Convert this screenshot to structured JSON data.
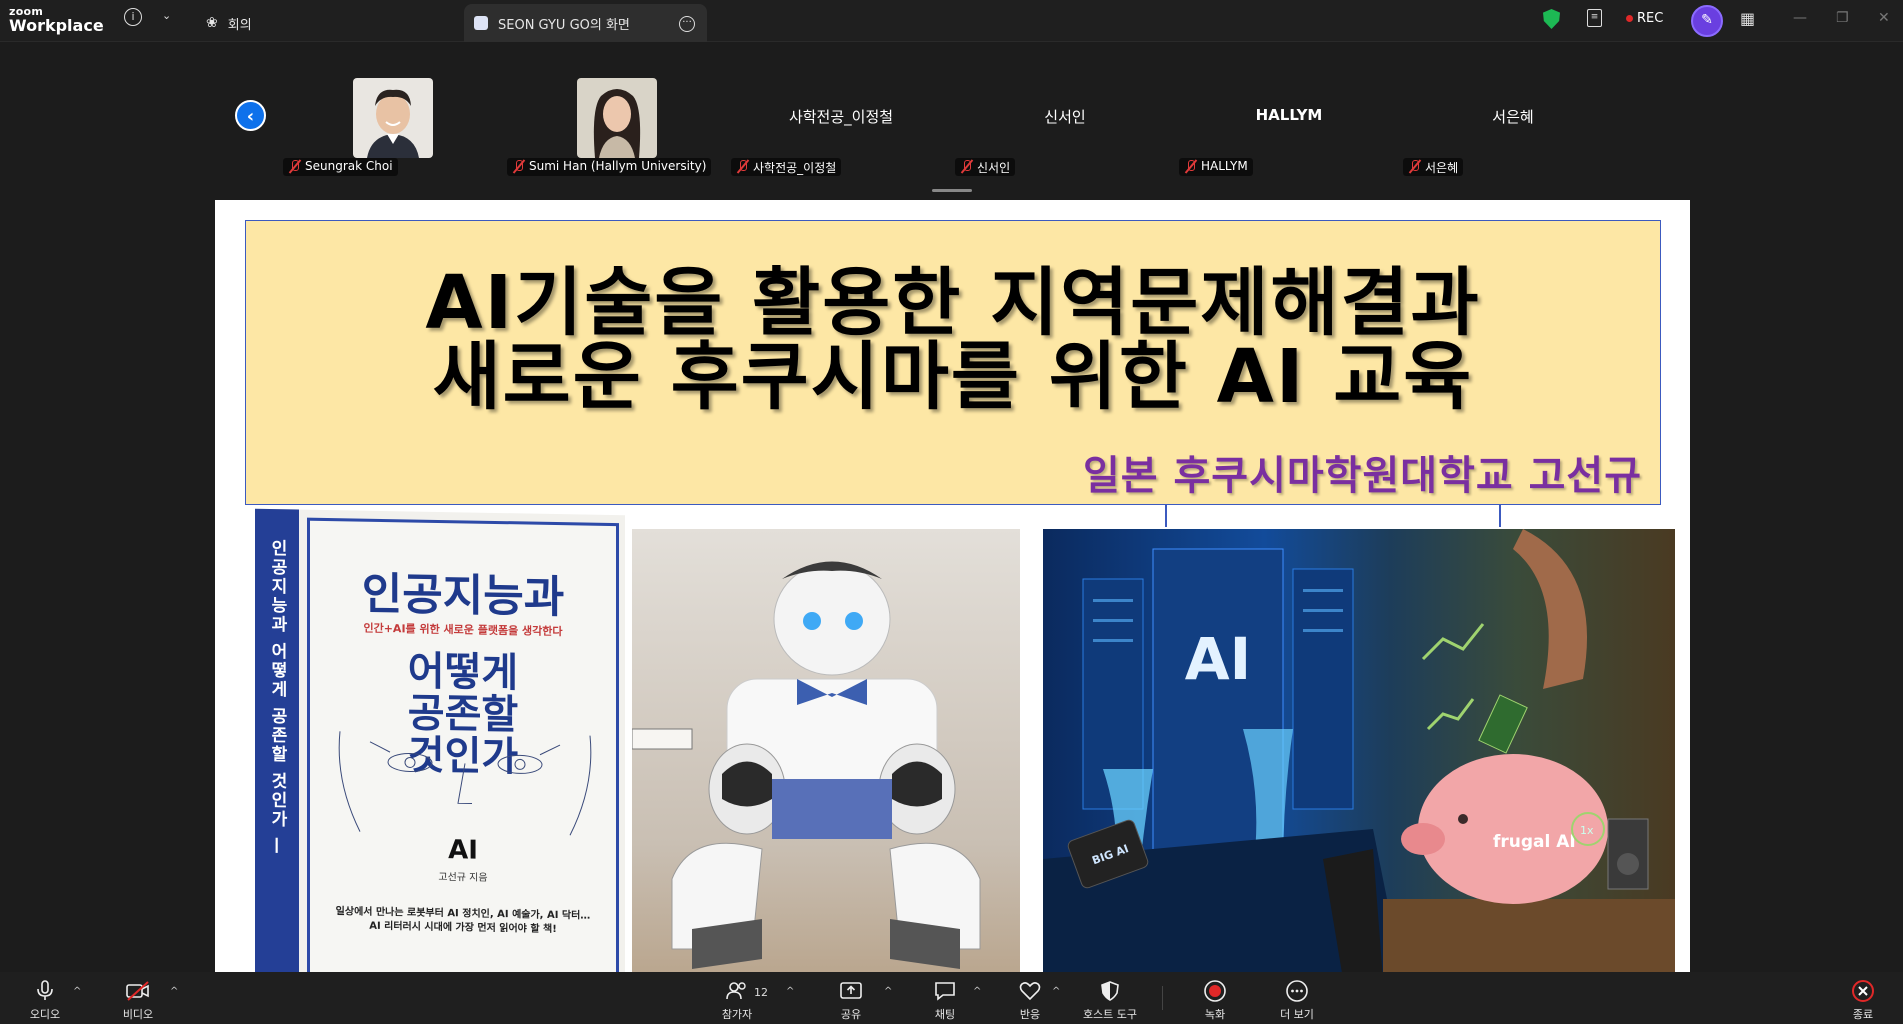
{
  "titlebar": {
    "brand_top": "zoom",
    "brand_bottom": "Workplace",
    "tabs": [
      {
        "label": "회의"
      },
      {
        "label": "SEON GYU GO의 화면"
      }
    ],
    "rec_label": "REC"
  },
  "gallery": {
    "participants": [
      {
        "label": "Seungrak Choi",
        "display": ""
      },
      {
        "label": "Sumi Han (Hallym University)",
        "display": ""
      },
      {
        "label": "사학전공_이정철",
        "display": "사학전공_이정철"
      },
      {
        "label": "신서인",
        "display": "신서인"
      },
      {
        "label": "HALLYM",
        "display": "HALLYM"
      },
      {
        "label": "서은혜",
        "display": "서은혜"
      }
    ]
  },
  "slide": {
    "title_line1": "AI기술을 활용한 지역문제해결과",
    "title_line2": "새로운 후쿠시마를 위한 AI 교육",
    "author": "일본 후쿠시마학원대학교 고선규",
    "book": {
      "spine": "인공지능과 어떻게 공존할 것인가 —",
      "title1": "인공지능과",
      "subtitle": "인간+AI를 위한 새로운 플랫폼을 생각한다",
      "title2": "어떻게\n공존할\n것인가",
      "logo": "AI",
      "author": "고선규 지음",
      "blurb": "일상에서 만나는 로봇부터 AI 정치인, AI 예술가, AI 닥터…\nAI 리터러시 시대에 가장 먼저 읽어야 할 책!"
    },
    "ai_image": {
      "ai_text": "AI",
      "chip_text": "BIG AI",
      "pig_text": "frugal AI",
      "badge": "1x"
    }
  },
  "toolbar": {
    "audio": "오디오",
    "video": "비디오",
    "participants": "참가자",
    "participant_count": "12",
    "share": "공유",
    "chat": "채팅",
    "reactions": "반응",
    "host_tools": "호스트 도구",
    "record": "녹화",
    "more": "더 보기",
    "end": "종료"
  },
  "colors": {
    "accent": "#0e71eb",
    "record_red": "#e02828",
    "title_box_bg": "#fde7a5",
    "author_purple": "#7a2fa0",
    "book_blue": "#1f3a8c"
  }
}
